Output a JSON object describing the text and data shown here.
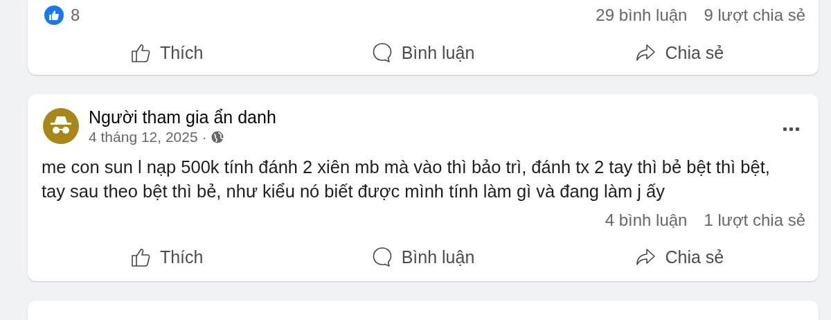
{
  "posts": [
    {
      "kind": "cut-top",
      "reactions": {
        "count": "8"
      },
      "comments": "29 bình luận",
      "shares": "9 lượt chia sẻ",
      "actions": [
        {
          "kind": "like",
          "label": "Thích"
        },
        {
          "kind": "comment",
          "label": "Bình luận"
        },
        {
          "kind": "share",
          "label": "Chia sẻ"
        }
      ]
    },
    {
      "kind": "full",
      "author": "Người tham gia ẩn danh",
      "date": "4 tháng 12, 2025",
      "separator": "·",
      "text": "me con sun l nạp 500k tính đánh 2 xiên mb mà vào thì bảo trì, đánh tx 2 tay thì bẻ bệt thì bệt, tay sau theo bệt thì bẻ, như kiểu nó biết được mình tính làm gì và đang làm j ấy",
      "comments": "4 bình luận",
      "shares": "1 lượt chia sẻ",
      "actions": [
        {
          "kind": "like",
          "label": "Thích"
        },
        {
          "kind": "comment",
          "label": "Bình luận"
        },
        {
          "kind": "share",
          "label": "Chia sẻ"
        }
      ]
    },
    {
      "kind": "cut-bottom"
    }
  ]
}
